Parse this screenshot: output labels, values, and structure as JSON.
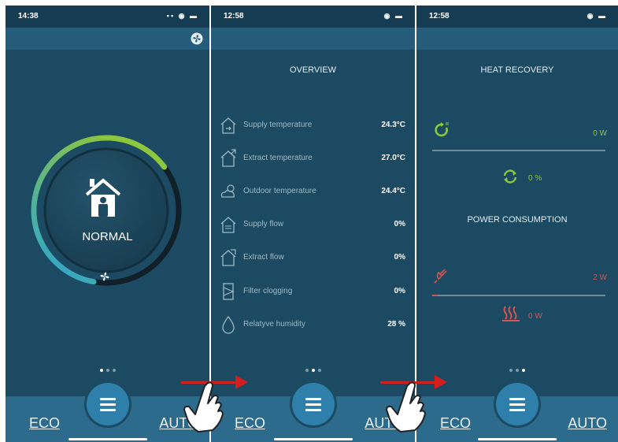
{
  "colors": {
    "background": "#1c4a62",
    "bottom_bar": "#2d6b8d",
    "menu_button": "#2f7fab",
    "gauge_green": "#8dc63f",
    "gauge_blue": "#29a3d6",
    "gauge_dark": "#101f28",
    "value_green": "#8dc63f",
    "value_red": "#d9534f",
    "swipe_arrow": "#d41e1e"
  },
  "screen1": {
    "status_time": "14:38",
    "mode_label": "NORMAL",
    "gauge_level": 0.62,
    "eco_label": "ECO",
    "auto_label": "AUTO",
    "active_page": 1
  },
  "screen2": {
    "status_time": "12:58",
    "title": "OVERVIEW",
    "rows": [
      {
        "icon": "house-supply-icon",
        "label": "Supply temperature",
        "value": "24.3°C"
      },
      {
        "icon": "house-extract-icon",
        "label": "Extract temperature",
        "value": "27.0°C"
      },
      {
        "icon": "outdoor-cloud-sun-icon",
        "label": "Outdoor temperature",
        "value": "24.4°C"
      },
      {
        "icon": "supply-flow-icon",
        "label": "Supply flow",
        "value": "0%"
      },
      {
        "icon": "extract-flow-icon",
        "label": "Extract flow",
        "value": "0%"
      },
      {
        "icon": "filter-icon",
        "label": "Filter clogging",
        "value": "0%"
      },
      {
        "icon": "water-drop-icon",
        "label": "Relatyve humidity",
        "value": "28 %"
      }
    ],
    "eco_label": "ECO",
    "auto_label": "AUTO",
    "active_page": 2
  },
  "screen3": {
    "status_time": "12:58",
    "title": "HEAT RECOVERY",
    "heat_recovery_power": "0 W",
    "heat_recovery_percent": "0 %",
    "power_title": "POWER CONSUMPTION",
    "power_value": "2 W",
    "power_level": 0.03,
    "heater_value": "0 W",
    "eco_label": "ECO",
    "auto_label": "AUTO",
    "active_page": 3
  }
}
